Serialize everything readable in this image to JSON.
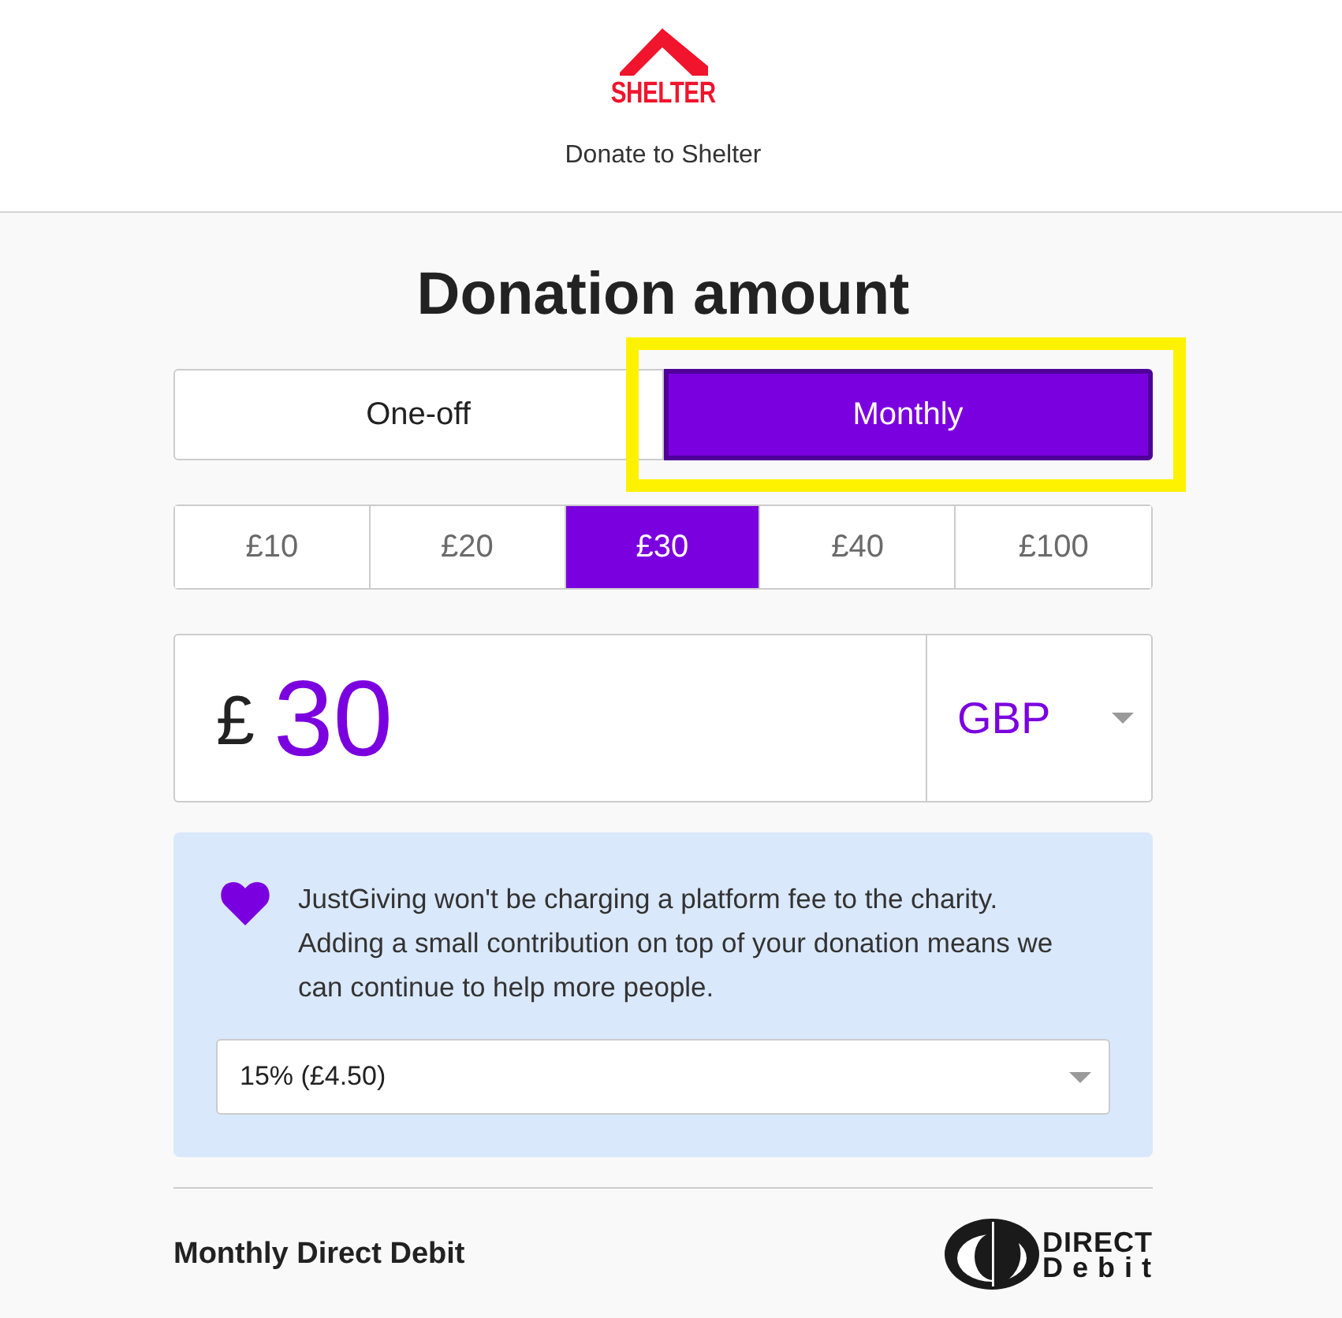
{
  "header": {
    "logo_text": "SHELTER",
    "title": "Donate to Shelter"
  },
  "heading": "Donation amount",
  "frequency_options": [
    {
      "label": "One-off",
      "selected": false,
      "highlighted": false
    },
    {
      "label": "Monthly",
      "selected": true,
      "highlighted": true
    }
  ],
  "amount_options": [
    {
      "label": "£10",
      "selected": false
    },
    {
      "label": "£20",
      "selected": false
    },
    {
      "label": "£30",
      "selected": true
    },
    {
      "label": "£40",
      "selected": false
    },
    {
      "label": "£100",
      "selected": false
    }
  ],
  "amount_field": {
    "currency_symbol": "£",
    "value": "30",
    "currency": "GBP"
  },
  "platform_fee_notice": {
    "text": "JustGiving won't be charging a platform fee to the charity. Adding a small contribution on top of your donation means we can continue to help more people.",
    "contribution_select": {
      "value": "15% (£4.50)"
    }
  },
  "payment": {
    "label": "Monthly Direct Debit",
    "logo_lines": [
      "DIRECT",
      "Debit"
    ]
  }
}
